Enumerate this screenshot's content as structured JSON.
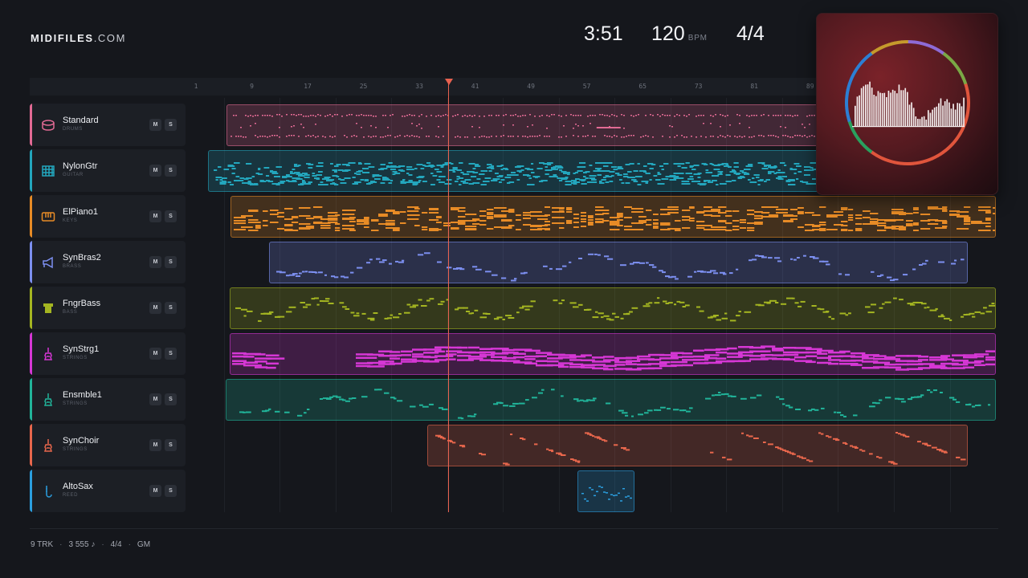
{
  "brand": {
    "name_bold": "MIDIFILES",
    "name_light": ".COM"
  },
  "transport": {
    "time": "3:51",
    "tempo": "120",
    "tempo_unit": "BPM",
    "time_signature": "4/4"
  },
  "ruler": {
    "bars": [
      "1",
      "9",
      "17",
      "25",
      "33",
      "41",
      "49",
      "57",
      "65",
      "73",
      "81",
      "89"
    ]
  },
  "playhead_bar": 38,
  "tracks": [
    {
      "name": "Standard",
      "category": "DRUMS",
      "color": "#e26a94",
      "icon": "drum-icon",
      "mute": "M",
      "solo": "S",
      "style": "drums"
    },
    {
      "name": "NylonGtr",
      "category": "GUITAR",
      "color": "#23a6bd",
      "icon": "guitar-fretboard-icon",
      "mute": "M",
      "solo": "S",
      "style": "dense"
    },
    {
      "name": "ElPiano1",
      "category": "KEYS",
      "color": "#e78b26",
      "icon": "keyboard-icon",
      "mute": "M",
      "solo": "S",
      "style": "chords"
    },
    {
      "name": "SynBras2",
      "category": "BRASS",
      "color": "#7c8ff0",
      "icon": "horn-icon",
      "mute": "M",
      "solo": "S",
      "style": "sparse"
    },
    {
      "name": "FngrBass",
      "category": "BASS",
      "color": "#a4b521",
      "icon": "bass-icon",
      "mute": "M",
      "solo": "S",
      "style": "bass"
    },
    {
      "name": "SynStrg1",
      "category": "STRINGS",
      "color": "#d637d5",
      "icon": "violin-icon",
      "mute": "M",
      "solo": "S",
      "style": "pad"
    },
    {
      "name": "Ensmble1",
      "category": "STRINGS",
      "color": "#21b49a",
      "icon": "violin-icon",
      "mute": "M",
      "solo": "S",
      "style": "sparse"
    },
    {
      "name": "SynChoir",
      "category": "STRINGS",
      "color": "#e8674c",
      "icon": "violin-icon",
      "mute": "M",
      "solo": "S",
      "style": "descend"
    },
    {
      "name": "AltoSax",
      "category": "REED",
      "color": "#2b9fe0",
      "icon": "sax-icon",
      "mute": "M",
      "solo": "S",
      "style": "short"
    }
  ],
  "footer": {
    "tracks": "9 TRK",
    "notes": "3 555 ♪",
    "signature": "4/4",
    "standard": "GM"
  }
}
